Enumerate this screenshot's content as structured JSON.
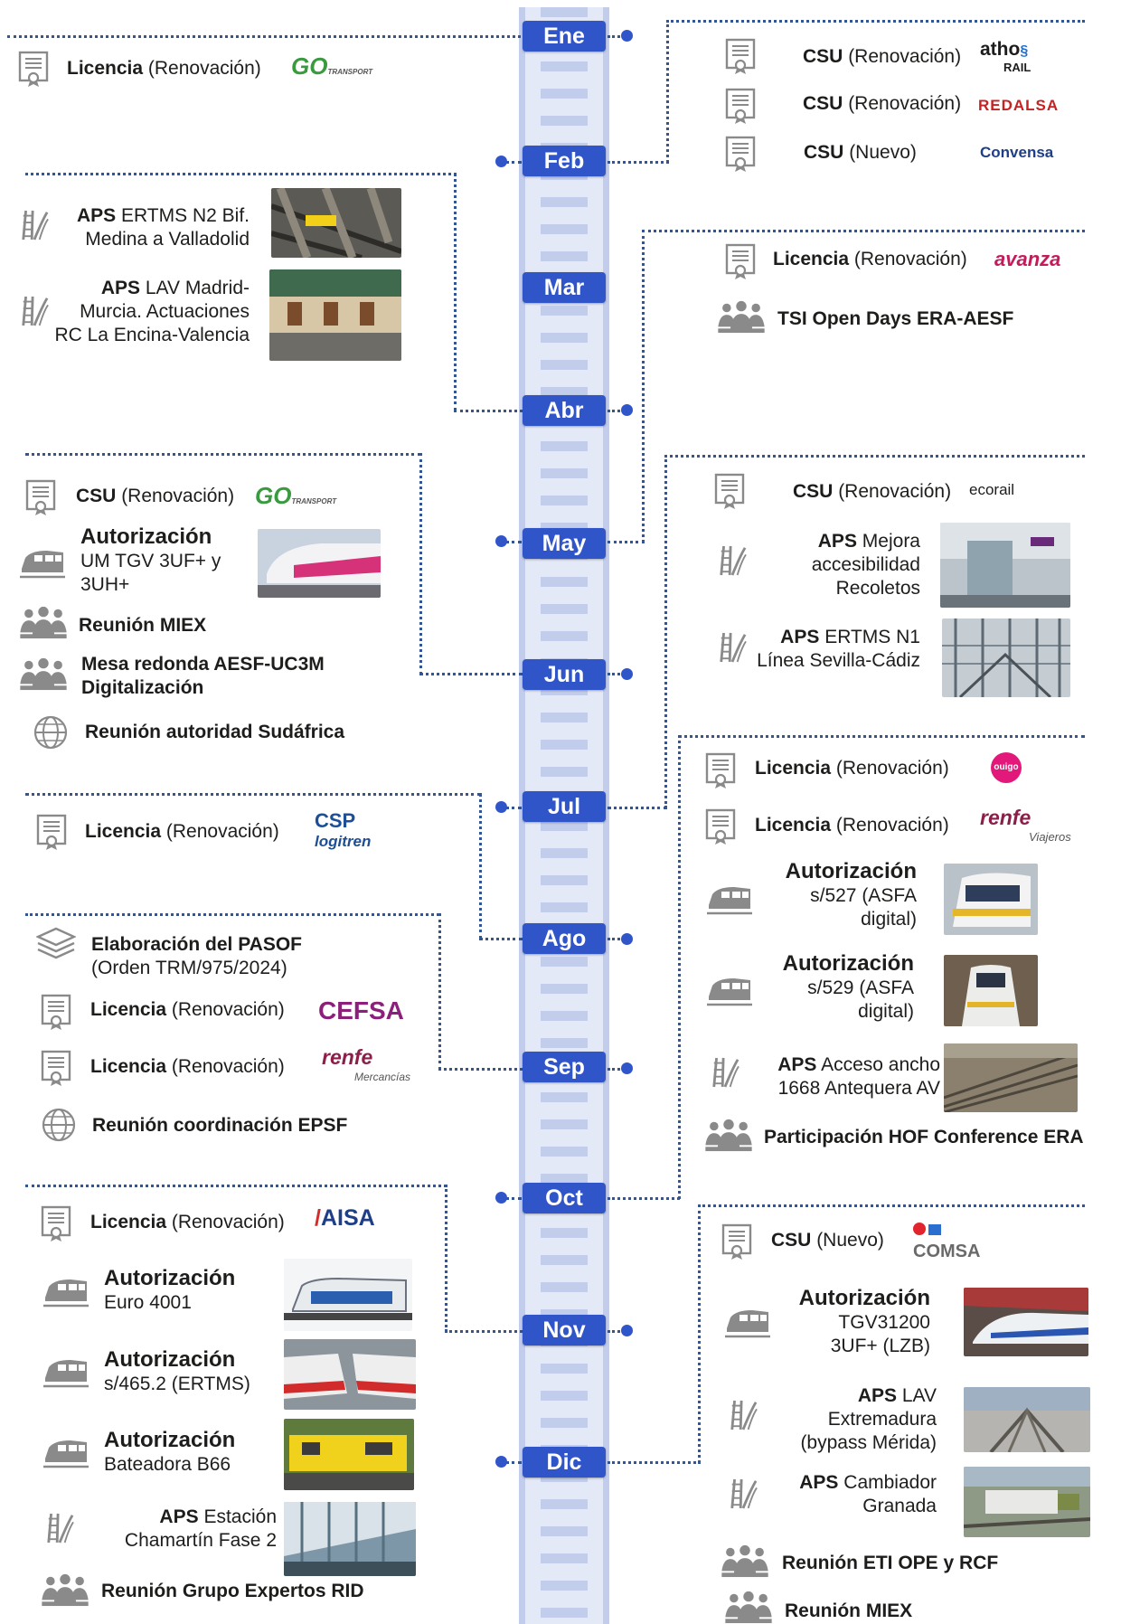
{
  "months": [
    "Ene",
    "Feb",
    "Mar",
    "Abr",
    "May",
    "Jun",
    "Jul",
    "Ago",
    "Sep",
    "Oct",
    "Nov",
    "Dic"
  ],
  "labels": {
    "licencia": "Licencia",
    "csu": "CSU",
    "aps": "APS",
    "autorizacion": "Autorización",
    "renovacion": "(Renovación)",
    "nuevo": "(Nuevo)"
  },
  "items": {
    "aps_medina": "ERTMS N2 Bif.",
    "aps_medina_2": "Medina a Valladolid",
    "aps_murcia": "LAV Madrid-",
    "aps_murcia_2": "Murcia. Actuaciones",
    "aps_murcia_3": "RC La Encina-Valencia",
    "tsi": "TSI Open Days ERA-AESF",
    "aut_tgv": "UM TGV 3UF+ y",
    "aut_tgv_2": "3UH+",
    "reunion_miex": "Reunión MIEX",
    "mesa": "Mesa redonda AESF-UC3M",
    "mesa_2": "Digitalización",
    "sudafrica": "Reunión autoridad Sudáfrica",
    "aps_recoletos": "Mejora",
    "aps_recoletos_2": "accesibilidad",
    "aps_recoletos_3": "Recoletos",
    "aps_sevilla": "ERTMS N1",
    "aps_sevilla_2": "Línea Sevilla-Cádiz",
    "pasof": "Elaboración del PASOF",
    "pasof_2": "(Orden TRM/975/2024)",
    "epsf": "Reunión coordinación EPSF",
    "aut_527": "s/527 (ASFA",
    "aut_527_2": "digital)",
    "aut_529": "s/529 (ASFA",
    "aut_529_2": "digital)",
    "aps_antequera": "Acceso ancho",
    "aps_antequera_2": "1668 Antequera AV",
    "hof": "Participación HOF Conference ERA",
    "aut_euro": "Euro 4001",
    "aut_465": "s/465.2 (ERTMS)",
    "aut_batea": "Bateadora B66",
    "aps_chamartin": "Estación",
    "aps_chamartin_2": "Chamartín Fase 2",
    "rid": "Reunión Grupo Expertos RID",
    "aut_tgv31200": "TGV31200",
    "aut_tgv31200_2": "3UF+ (LZB)",
    "aps_extremadura": "LAV",
    "aps_extremadura_2": "Extremadura",
    "aps_extremadura_3": "(bypass Mérida)",
    "aps_granada": "Cambiador",
    "aps_granada_2": "Granada",
    "eti": "Reunión ETI OPE y RCF",
    "miex_dic": "Reunión MIEX"
  },
  "logos": {
    "go_transport": "GO",
    "go_transport_sub": "TRANSPORT",
    "atho_rail": "atho",
    "atho_rail_sub": "RAIL",
    "redalsa": "REDALSA",
    "convensa": "Convensa",
    "avanza": "avanza",
    "ecorail": "ecorail",
    "ouigo": "ouigo",
    "renfe": "renfe",
    "renfe_viajeros": "Viajeros",
    "renfe_mercancias": "Mercancías",
    "csp": "CSP",
    "logitren": "logitren",
    "cefsa": "CEFSA",
    "aisa": "AISA",
    "comsa": "COMSA"
  },
  "colors": {
    "accent": "#2f55c9",
    "dotted": "#34558f",
    "icon": "#8a8a8a",
    "spine": "#e4e9f7"
  }
}
